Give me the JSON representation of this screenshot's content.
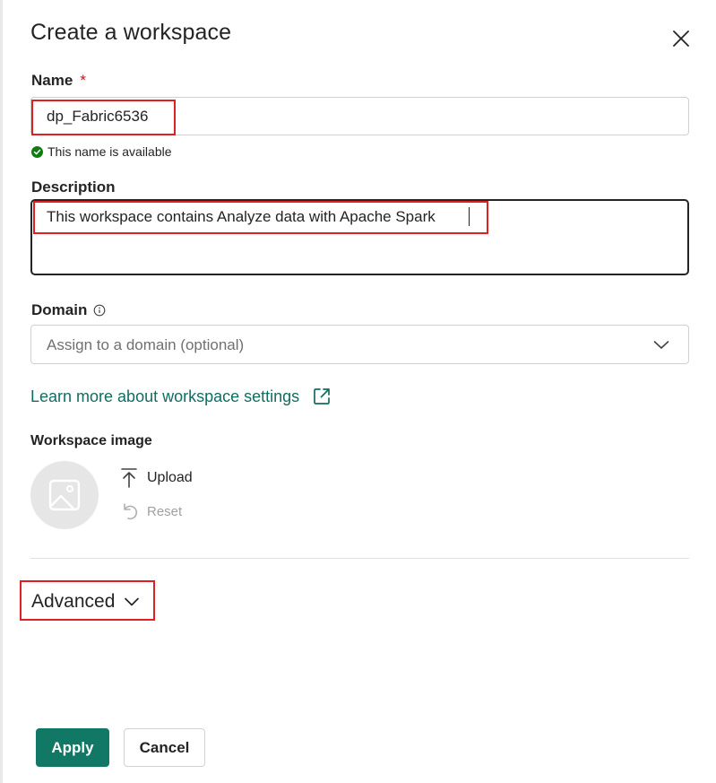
{
  "dialog": {
    "title": "Create a workspace"
  },
  "name": {
    "label": "Name",
    "required_mark": "*",
    "value": "dp_Fabric6536",
    "status": "This name is available"
  },
  "description": {
    "label": "Description",
    "value": "This workspace contains Analyze data with Apache Spark"
  },
  "domain": {
    "label": "Domain",
    "placeholder": "Assign to a domain (optional)"
  },
  "learn_more": {
    "label": "Learn more about workspace settings"
  },
  "workspace_image": {
    "label": "Workspace image",
    "upload_label": "Upload",
    "reset_label": "Reset"
  },
  "advanced": {
    "label": "Advanced"
  },
  "footer": {
    "apply_label": "Apply",
    "cancel_label": "Cancel"
  },
  "colors": {
    "primary": "#117865",
    "link": "#0f6d62",
    "success": "#107c10",
    "required": "#c50f1f",
    "highlight": "#e02020"
  },
  "icons": [
    "close-icon",
    "check-circle-icon",
    "info-icon",
    "chevron-down-icon",
    "open-external-icon",
    "image-placeholder-icon",
    "upload-icon",
    "reset-icon"
  ]
}
